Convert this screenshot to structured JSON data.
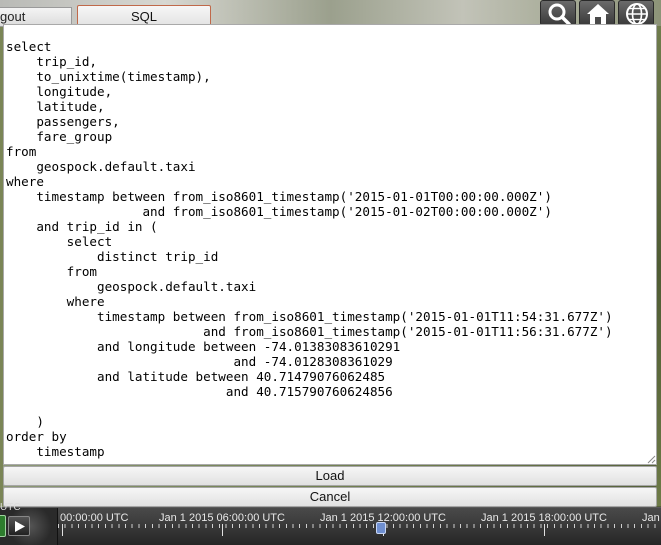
{
  "toolbar": {
    "logout_label": "gout",
    "sql_label": "SQL"
  },
  "editor": {
    "query": "select\n    trip_id,\n    to_unixtime(timestamp),\n    longitude,\n    latitude,\n    passengers,\n    fare_group\nfrom\n    geospock.default.taxi\nwhere\n    timestamp between from_iso8601_timestamp('2015-01-01T00:00:00.000Z')\n                  and from_iso8601_timestamp('2015-01-02T00:00:00.000Z')\n    and trip_id in (\n        select\n            distinct trip_id\n        from\n            geospock.default.taxi\n        where\n            timestamp between from_iso8601_timestamp('2015-01-01T11:54:31.677Z')\n                          and from_iso8601_timestamp('2015-01-01T11:56:31.677Z')\n            and longitude between -74.01383083610291\n                              and -74.0128308361029\n            and latitude between 40.71479076062485\n                             and 40.715790760624856\n\n    )\norder by\n    timestamp"
  },
  "dialog": {
    "load_label": "Load",
    "cancel_label": "Cancel"
  },
  "timeline": {
    "utc_label": "UTC",
    "labels": [
      "00:00:00 UTC",
      "Jan 1 2015 06:00:00 UTC",
      "Jan 1 2015 12:00:00 UTC",
      "Jan 1 2015 18:00:00 UTC",
      "Jan"
    ]
  },
  "icons": {
    "search": "search-icon",
    "home": "home-icon",
    "globe": "globe-icon",
    "play": "play-icon"
  }
}
